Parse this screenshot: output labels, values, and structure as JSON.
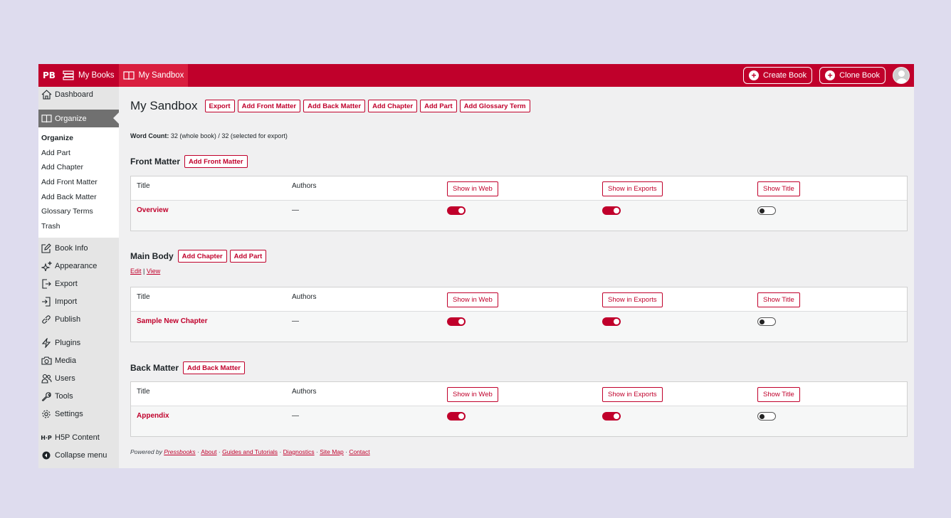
{
  "topbar": {
    "logo": "PB",
    "my_books": "My Books",
    "my_sandbox": "My Sandbox",
    "create_book": "Create Book",
    "clone_book": "Clone Book"
  },
  "sidebar": {
    "dashboard": "Dashboard",
    "organize": "Organize",
    "submenu": [
      "Organize",
      "Add Part",
      "Add Chapter",
      "Add Front Matter",
      "Add Back Matter",
      "Glossary Terms",
      "Trash"
    ],
    "book_info": "Book Info",
    "appearance": "Appearance",
    "export": "Export",
    "import": "Import",
    "publish": "Publish",
    "plugins": "Plugins",
    "media": "Media",
    "users": "Users",
    "tools": "Tools",
    "settings": "Settings",
    "h5p": "H5P Content",
    "collapse": "Collapse menu"
  },
  "header": {
    "title": "My Sandbox",
    "buttons": [
      "Export",
      "Add Front Matter",
      "Add Back Matter",
      "Add Chapter",
      "Add Part",
      "Add Glossary Term"
    ]
  },
  "wordcount": {
    "label": "Word Count:",
    "value": "32 (whole book) / 32 (selected for export)"
  },
  "table_headers": {
    "title": "Title",
    "authors": "Authors",
    "show_web": "Show in Web",
    "show_exports": "Show in Exports",
    "show_title": "Show Title"
  },
  "front_matter": {
    "title": "Front Matter",
    "add_button": "Add Front Matter",
    "row": {
      "title": "Overview",
      "authors": "—",
      "web": true,
      "exports": true,
      "show_title": false
    }
  },
  "main_body": {
    "title": "Main Body",
    "add_chapter": "Add Chapter",
    "add_part": "Add Part",
    "edit": "Edit",
    "separator": "|",
    "view": "View",
    "row": {
      "title": "Sample New Chapter",
      "authors": "—",
      "web": true,
      "exports": true,
      "show_title": false
    }
  },
  "back_matter": {
    "title": "Back Matter",
    "add_button": "Add Back Matter",
    "row": {
      "title": "Appendix",
      "authors": "—",
      "web": true,
      "exports": true,
      "show_title": false
    }
  },
  "footer": {
    "powered_by": "Powered by",
    "pressbooks": "Pressbooks",
    "sep": "·",
    "links": [
      "About",
      "Guides and Tutorials",
      "Diagnostics",
      "Site Map",
      "Contact"
    ]
  },
  "colors": {
    "brand": "#c0002b",
    "background": "#dedcee",
    "sidebar": "#e5e5e5"
  }
}
